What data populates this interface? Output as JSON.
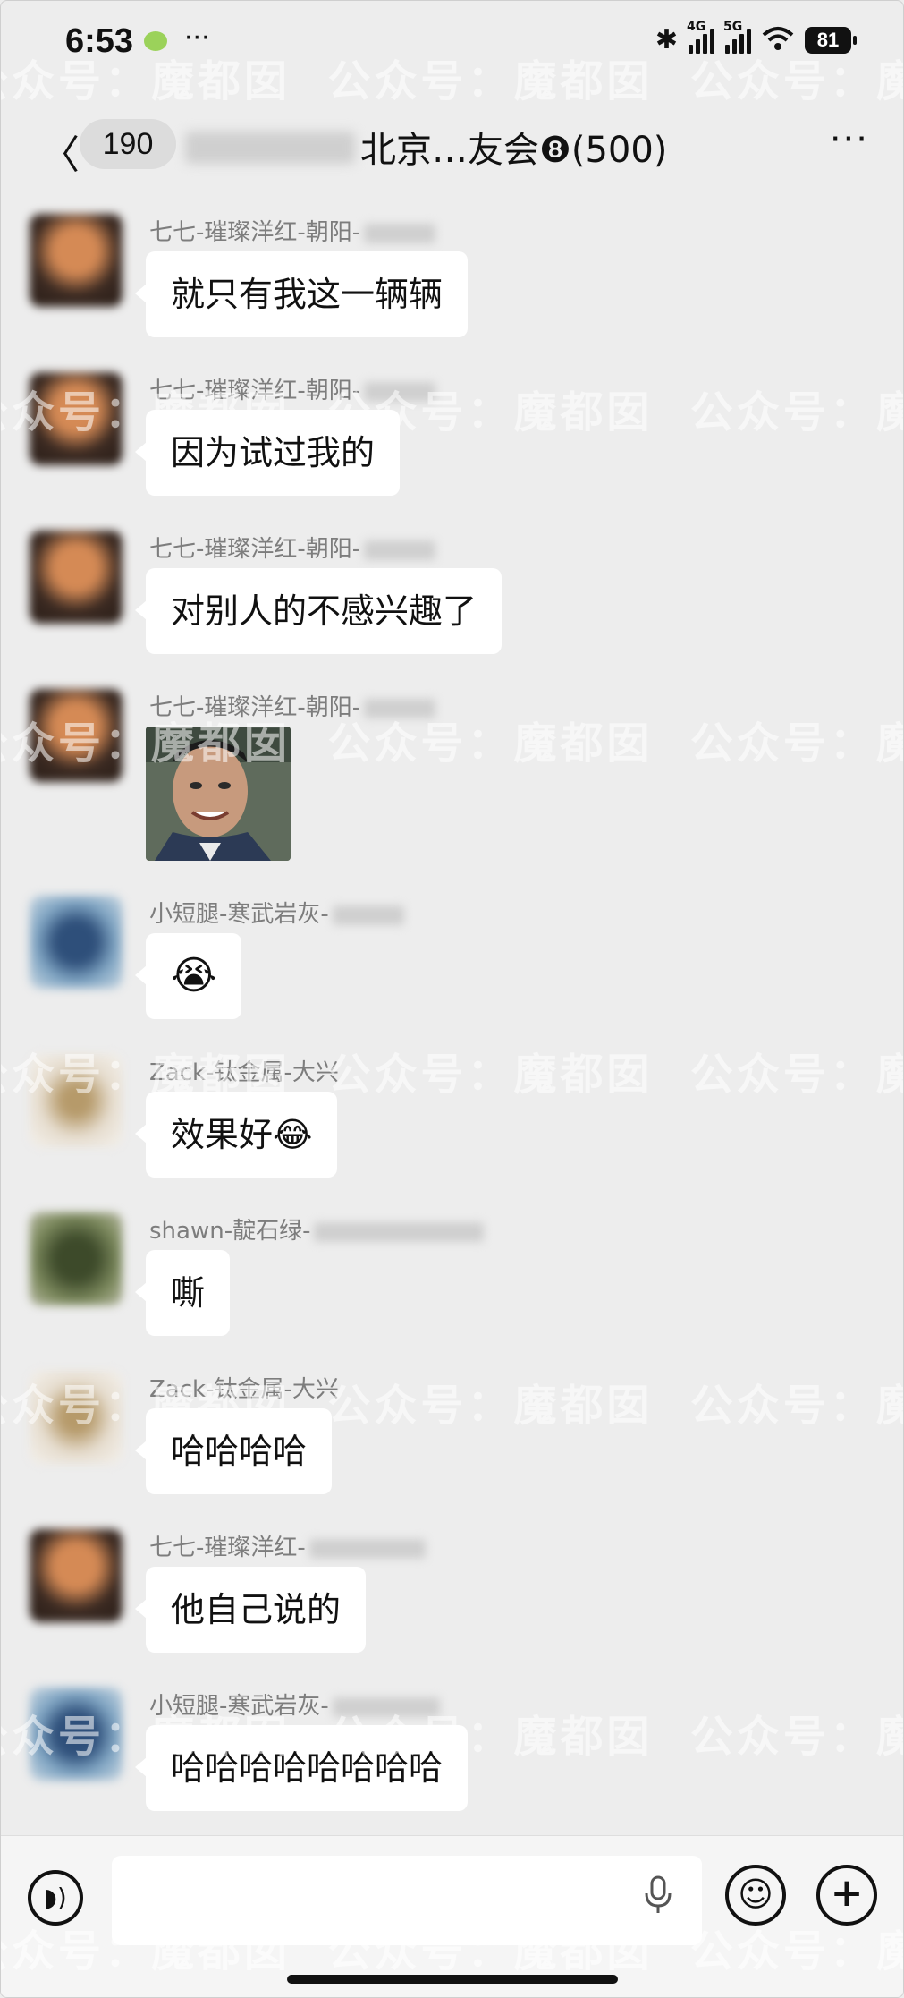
{
  "status_bar": {
    "time": "6:53",
    "network_4g": "4G",
    "network_5g": "5G",
    "battery": "81",
    "more": "···"
  },
  "nav": {
    "unread_count": "190",
    "title": "北京…友会❽(500)",
    "more": "···"
  },
  "watermark": "公众号：魔都囡",
  "messages": [
    {
      "name": "七七-璀璨洋红-朝阳-",
      "text": "就只有我这一辆辆"
    },
    {
      "name": "七七-璀璨洋红-朝阳-",
      "text": "因为试过我的"
    },
    {
      "name": "七七-璀璨洋红-朝阳-",
      "text": "对别人的不感兴趣了"
    },
    {
      "name": "七七-璀璨洋红-朝阳-",
      "text": ""
    },
    {
      "name": "小短腿-寒武岩灰-",
      "text": "😭"
    },
    {
      "name": "Zack-钛金属-大兴",
      "text": "效果好😂"
    },
    {
      "name": "shawn-靛石绿-",
      "text": "嘶"
    },
    {
      "name": "Zack-钛金属-大兴",
      "text": "哈哈哈哈"
    },
    {
      "name": "七七-璀璨洋红-",
      "text": "他自己说的"
    },
    {
      "name": "小短腿-寒武岩灰-",
      "text": "哈哈哈哈哈哈哈哈"
    }
  ],
  "input_bar": {
    "placeholder": ""
  }
}
